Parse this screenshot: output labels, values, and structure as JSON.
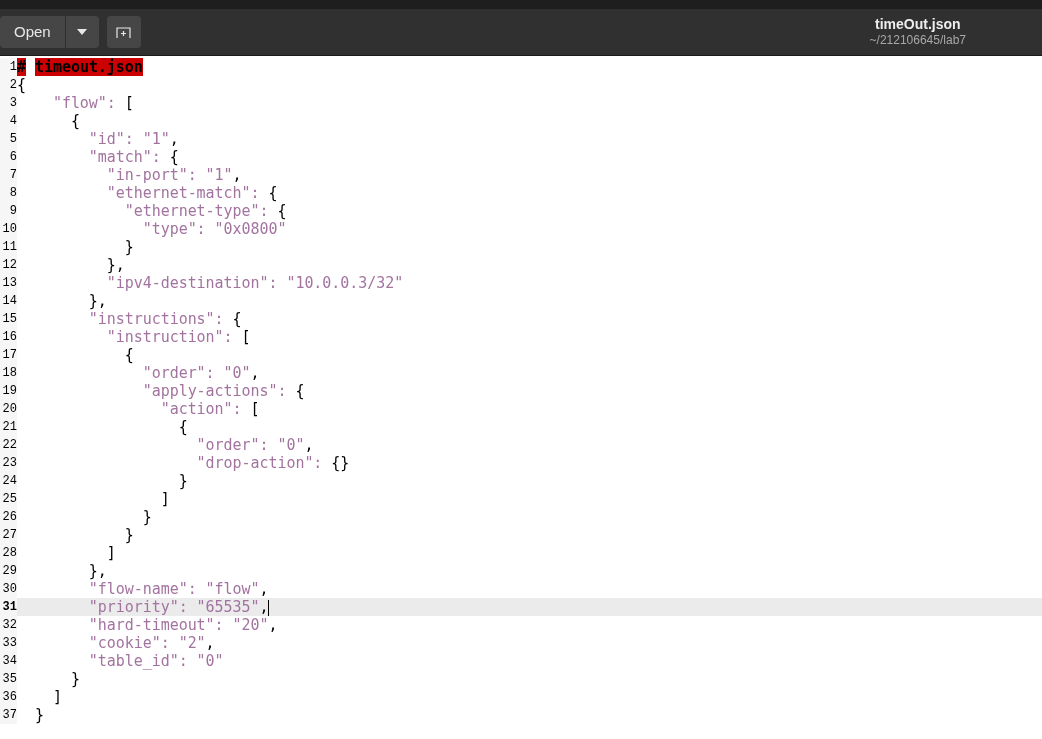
{
  "toolbar": {
    "open_button": "Open",
    "title": "timeOut.json",
    "subtitle": "~/212106645/lab7"
  },
  "lines": [
    {
      "number": "1",
      "current": false,
      "segments": [
        {
          "kind": "error",
          "text": "#"
        },
        {
          "kind": "error",
          "text": "timeout.json"
        }
      ]
    },
    {
      "number": "2",
      "current": false,
      "segments": [
        {
          "kind": "punct",
          "text": "{"
        }
      ]
    },
    {
      "number": "3",
      "current": false,
      "segments": [
        {
          "kind": "string",
          "text": "    \"flow\": "
        },
        {
          "kind": "punct",
          "text": "["
        }
      ]
    },
    {
      "number": "4",
      "current": false,
      "segments": [
        {
          "kind": "punct",
          "text": "      {"
        }
      ]
    },
    {
      "number": "5",
      "current": false,
      "segments": [
        {
          "kind": "string",
          "text": "        \"id\": \"1\""
        },
        {
          "kind": "punct",
          "text": ","
        }
      ]
    },
    {
      "number": "6",
      "current": false,
      "segments": [
        {
          "kind": "string",
          "text": "        \"match\": "
        },
        {
          "kind": "punct",
          "text": "{"
        }
      ]
    },
    {
      "number": "7",
      "current": false,
      "segments": [
        {
          "kind": "string",
          "text": "          \"in-port\": \"1\""
        },
        {
          "kind": "punct",
          "text": ","
        }
      ]
    },
    {
      "number": "8",
      "current": false,
      "segments": [
        {
          "kind": "string",
          "text": "          \"ethernet-match\": "
        },
        {
          "kind": "punct",
          "text": "{"
        }
      ]
    },
    {
      "number": "9",
      "current": false,
      "segments": [
        {
          "kind": "string",
          "text": "            \"ethernet-type\": "
        },
        {
          "kind": "punct",
          "text": "{"
        }
      ]
    },
    {
      "number": "10",
      "current": false,
      "segments": [
        {
          "kind": "string",
          "text": "              \"type\": \"0x0800\""
        }
      ]
    },
    {
      "number": "11",
      "current": false,
      "segments": [
        {
          "kind": "punct",
          "text": "            }"
        }
      ]
    },
    {
      "number": "12",
      "current": false,
      "segments": [
        {
          "kind": "punct",
          "text": "          },"
        }
      ]
    },
    {
      "number": "13",
      "current": false,
      "segments": [
        {
          "kind": "string",
          "text": "          \"ipv4-destination\": \"10.0.0.3/32\""
        }
      ]
    },
    {
      "number": "14",
      "current": false,
      "segments": [
        {
          "kind": "punct",
          "text": "        },"
        }
      ]
    },
    {
      "number": "15",
      "current": false,
      "segments": [
        {
          "kind": "string",
          "text": "        \"instructions\": "
        },
        {
          "kind": "punct",
          "text": "{"
        }
      ]
    },
    {
      "number": "16",
      "current": false,
      "segments": [
        {
          "kind": "string",
          "text": "          \"instruction\": "
        },
        {
          "kind": "punct",
          "text": "["
        }
      ]
    },
    {
      "number": "17",
      "current": false,
      "segments": [
        {
          "kind": "punct",
          "text": "            {"
        }
      ]
    },
    {
      "number": "18",
      "current": false,
      "segments": [
        {
          "kind": "string",
          "text": "              \"order\": \"0\""
        },
        {
          "kind": "punct",
          "text": ","
        }
      ]
    },
    {
      "number": "19",
      "current": false,
      "segments": [
        {
          "kind": "string",
          "text": "              \"apply-actions\": "
        },
        {
          "kind": "punct",
          "text": "{"
        }
      ]
    },
    {
      "number": "20",
      "current": false,
      "segments": [
        {
          "kind": "string",
          "text": "                \"action\": "
        },
        {
          "kind": "punct",
          "text": "["
        }
      ]
    },
    {
      "number": "21",
      "current": false,
      "segments": [
        {
          "kind": "punct",
          "text": "                  {"
        }
      ]
    },
    {
      "number": "22",
      "current": false,
      "segments": [
        {
          "kind": "string",
          "text": "                    \"order\": \"0\""
        },
        {
          "kind": "punct",
          "text": ","
        }
      ]
    },
    {
      "number": "23",
      "current": false,
      "segments": [
        {
          "kind": "string",
          "text": "                    \"drop-action\": "
        },
        {
          "kind": "punct",
          "text": "{}"
        }
      ]
    },
    {
      "number": "24",
      "current": false,
      "segments": [
        {
          "kind": "punct",
          "text": "                  }"
        }
      ]
    },
    {
      "number": "25",
      "current": false,
      "segments": [
        {
          "kind": "punct",
          "text": "                ]"
        }
      ]
    },
    {
      "number": "26",
      "current": false,
      "segments": [
        {
          "kind": "punct",
          "text": "              }"
        }
      ]
    },
    {
      "number": "27",
      "current": false,
      "segments": [
        {
          "kind": "punct",
          "text": "            }"
        }
      ]
    },
    {
      "number": "28",
      "current": false,
      "segments": [
        {
          "kind": "punct",
          "text": "          ]"
        }
      ]
    },
    {
      "number": "29",
      "current": false,
      "segments": [
        {
          "kind": "punct",
          "text": "        },"
        }
      ]
    },
    {
      "number": "30",
      "current": false,
      "segments": [
        {
          "kind": "string",
          "text": "        \"flow-name\": \"flow\""
        },
        {
          "kind": "punct",
          "text": ","
        }
      ]
    },
    {
      "number": "31",
      "current": true,
      "segments": [
        {
          "kind": "string",
          "text": "        \"priority\": \"65535\""
        },
        {
          "kind": "punct",
          "text": ","
        }
      ]
    },
    {
      "number": "32",
      "current": false,
      "segments": [
        {
          "kind": "string",
          "text": "        \"hard-timeout\": \"20\""
        },
        {
          "kind": "punct",
          "text": ","
        }
      ]
    },
    {
      "number": "33",
      "current": false,
      "segments": [
        {
          "kind": "string",
          "text": "        \"cookie\": \"2\""
        },
        {
          "kind": "punct",
          "text": ","
        }
      ]
    },
    {
      "number": "34",
      "current": false,
      "segments": [
        {
          "kind": "string",
          "text": "        \"table_id\": \"0\""
        }
      ]
    },
    {
      "number": "35",
      "current": false,
      "segments": [
        {
          "kind": "punct",
          "text": "      }"
        }
      ]
    },
    {
      "number": "36",
      "current": false,
      "segments": [
        {
          "kind": "punct",
          "text": "    ]"
        }
      ]
    },
    {
      "number": "37",
      "current": false,
      "segments": [
        {
          "kind": "punct",
          "text": "  }"
        }
      ]
    }
  ]
}
